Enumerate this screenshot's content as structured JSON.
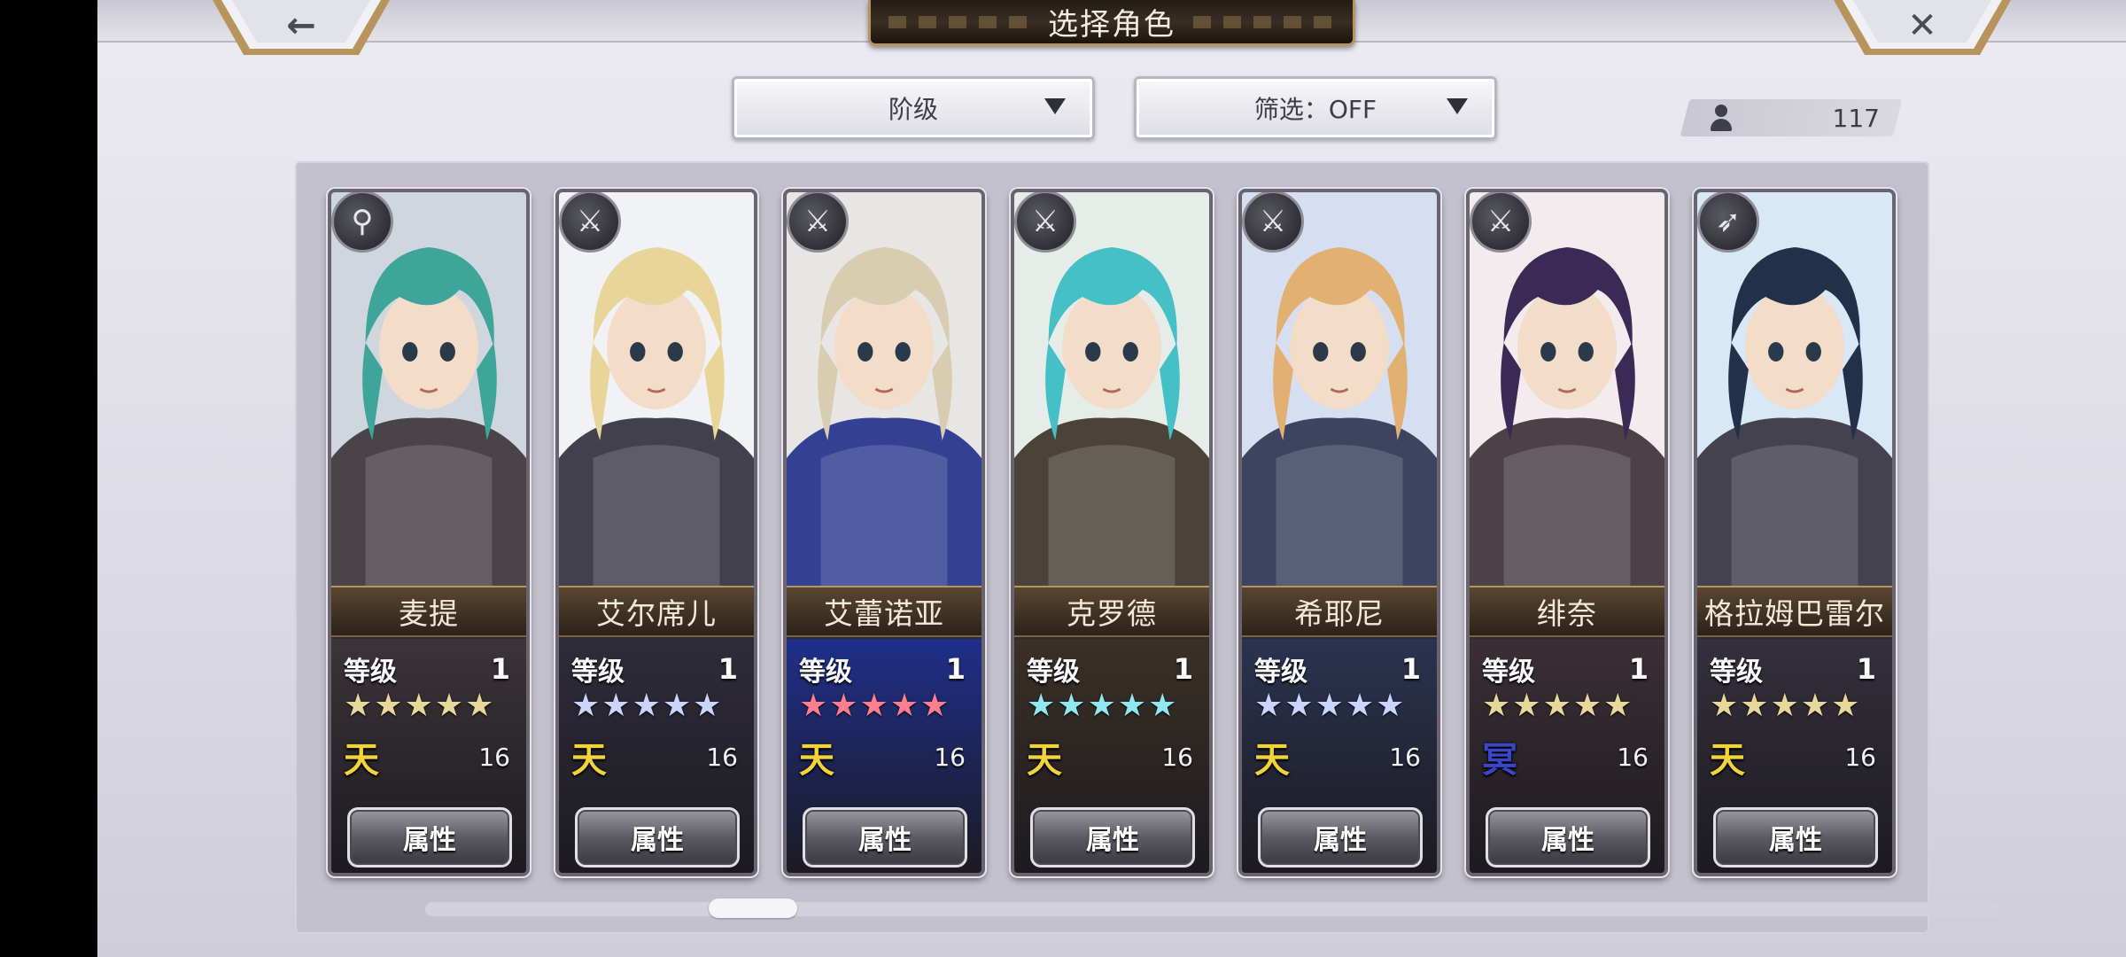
{
  "header": {
    "title": "选择角色",
    "back_glyph": "←",
    "close_glyph": "✕"
  },
  "filters": {
    "sort_label": "阶级",
    "filter_label": "筛选：OFF"
  },
  "roster_count": "117",
  "common": {
    "level_label": "等级",
    "attr_button": "属性"
  },
  "characters": [
    {
      "name": "麦提",
      "level": "1",
      "stars": 5,
      "star_color": "#e8d79a",
      "rank": "天",
      "rank_color": "#f2d33a",
      "rank_num": "16",
      "weapon_icon": "staff-icon",
      "weapon_glyph": "⚲",
      "hair": "#3fa59a",
      "bg": "#cfd6de",
      "panel": "#3b3438"
    },
    {
      "name": "艾尔席儿",
      "level": "1",
      "stars": 5,
      "star_color": "#c9d4ff",
      "rank": "天",
      "rank_color": "#f2d33a",
      "rank_num": "16",
      "weapon_icon": "sword-icon",
      "weapon_glyph": "⚔",
      "hair": "#e9d59a",
      "bg": "#f0f2f6",
      "panel": "#2f2c3a"
    },
    {
      "name": "艾蕾诺亚",
      "level": "1",
      "stars": 5,
      "star_color": "#ff7d8c",
      "rank": "天",
      "rank_color": "#f2d33a",
      "rank_num": "16",
      "weapon_icon": "sword-icon",
      "weapon_glyph": "⚔",
      "hair": "#d8cdb0",
      "bg": "#e8e6e4",
      "panel": "#1e2f8a"
    },
    {
      "name": "克罗德",
      "level": "1",
      "stars": 5,
      "star_color": "#8fe8f0",
      "rank": "天",
      "rank_color": "#f2d33a",
      "rank_num": "16",
      "weapon_icon": "sword-icon",
      "weapon_glyph": "⚔",
      "hair": "#45c0c6",
      "bg": "#e6ede9",
      "panel": "#3a3026"
    },
    {
      "name": "希耶尼",
      "level": "1",
      "stars": 5,
      "star_color": "#c9d4ff",
      "rank": "天",
      "rank_color": "#f2d33a",
      "rank_num": "16",
      "weapon_icon": "sword-icon",
      "weapon_glyph": "⚔",
      "hair": "#e2b070",
      "bg": "#d6def2",
      "panel": "#2b3350"
    },
    {
      "name": "绯奈",
      "level": "1",
      "stars": 5,
      "star_color": "#e8d79a",
      "rank": "冥",
      "rank_color": "#3a46c8",
      "rank_num": "16",
      "weapon_icon": "sword-icon",
      "weapon_glyph": "⚔",
      "hair": "#3a2a55",
      "bg": "#f2ecef",
      "panel": "#3a2f34"
    },
    {
      "name": "格拉姆巴雷尔",
      "level": "1",
      "stars": 5,
      "star_color": "#e8d79a",
      "rank": "天",
      "rank_color": "#f2d33a",
      "rank_num": "16",
      "weapon_icon": "spear-icon",
      "weapon_glyph": "➶",
      "hair": "#22304a",
      "bg": "#d8e8f6",
      "panel": "#34303c"
    }
  ]
}
